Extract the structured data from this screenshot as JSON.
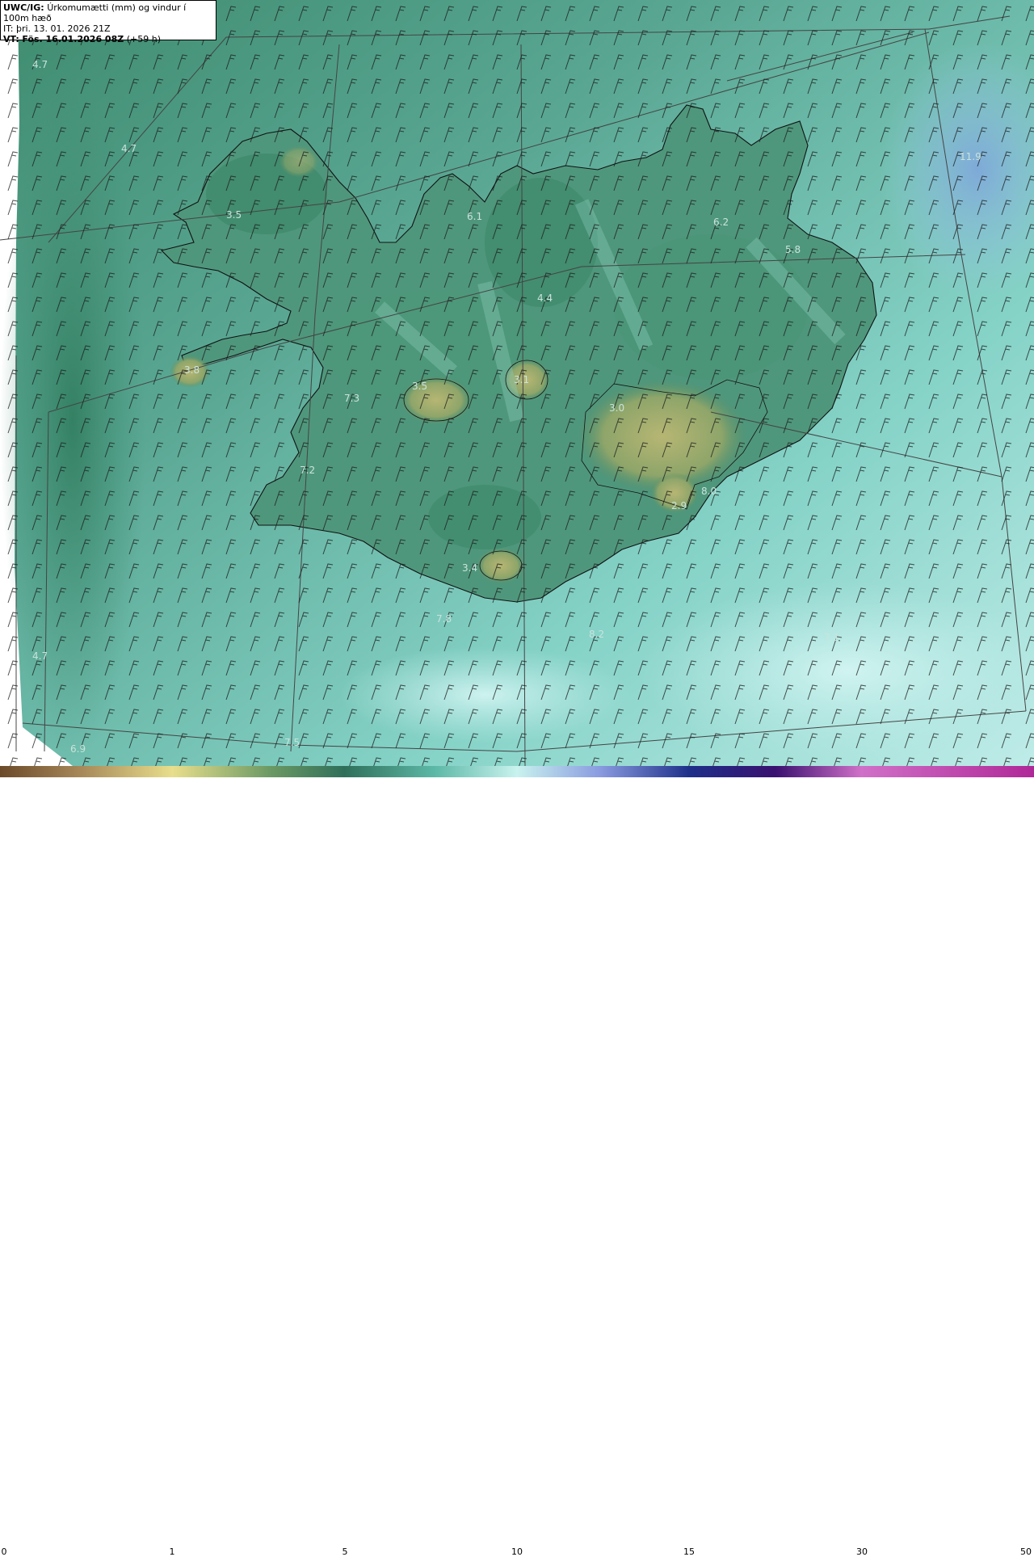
{
  "header": {
    "model": "UWC/IG:",
    "title": "Úrkomumætti (mm) og vindur í 100m hæð",
    "it_label": "IT:",
    "it_value": "þri. 13. 01. 2026 21Z",
    "vt_label": "VT:",
    "vt_value": "Fös. 16.01.2026 08Z",
    "lead": "(+59 h)"
  },
  "colorbar": {
    "ticks": [
      {
        "label": "0"
      },
      {
        "label": "1"
      },
      {
        "label": "5"
      },
      {
        "label": "10"
      },
      {
        "label": "15"
      },
      {
        "label": "30"
      },
      {
        "label": "50"
      }
    ],
    "colors": [
      "#6b4a2a",
      "#c8b47a",
      "#e8de8c",
      "#5f8f63",
      "#2f6f5a",
      "#7fd2c2",
      "#c9f2ee",
      "#8a9be0",
      "#1e2f8a",
      "#3a1070",
      "#d070c8",
      "#c23aa8"
    ]
  },
  "map": {
    "labels": [
      {
        "text": "4.7"
      },
      {
        "text": "4.7"
      },
      {
        "text": "3.5"
      },
      {
        "text": "6.1"
      },
      {
        "text": "6.2"
      },
      {
        "text": "11.9"
      },
      {
        "text": "5.8"
      },
      {
        "text": "4.4"
      },
      {
        "text": "3.8"
      },
      {
        "text": "3.5"
      },
      {
        "text": "3.1"
      },
      {
        "text": "7.3"
      },
      {
        "text": "3.0"
      },
      {
        "text": "7.2"
      },
      {
        "text": "8.0"
      },
      {
        "text": "2.9"
      },
      {
        "text": "3.4"
      },
      {
        "text": "7.8"
      },
      {
        "text": "8.2"
      },
      {
        "text": "7.1"
      },
      {
        "text": "4.7"
      },
      {
        "text": "6.9"
      },
      {
        "text": "7.5"
      }
    ]
  }
}
